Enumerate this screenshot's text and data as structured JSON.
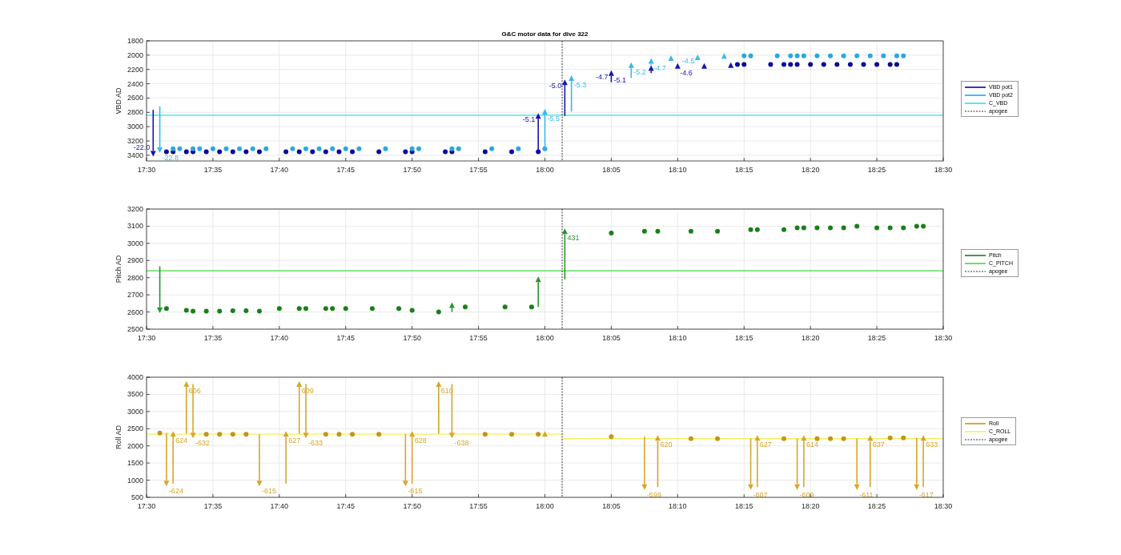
{
  "figure": {
    "title": "G&C motor data for dive 322"
  },
  "panels": [
    {
      "chart_data": {
        "type": "scatter",
        "ylabel": "VBD AD",
        "ylim": [
          3480,
          1800
        ],
        "grid": true,
        "categories": [
          "17:30",
          null,
          null,
          null,
          null,
          null,
          null,
          null,
          null,
          null,
          "17:35",
          null,
          null,
          null,
          null,
          null,
          null,
          null,
          null,
          null,
          "17:40",
          null,
          null,
          null,
          null,
          null,
          null,
          null,
          null,
          null,
          "17:45",
          null,
          null,
          null,
          null,
          null,
          null,
          null,
          null,
          null,
          "17:50",
          null,
          null,
          null,
          null,
          null,
          null,
          null,
          null,
          null,
          "17:55",
          null,
          null,
          null,
          null,
          null,
          null,
          null,
          null,
          null,
          "18:00",
          null,
          null,
          null,
          null,
          null,
          null,
          null,
          null,
          null,
          "18:05",
          null,
          null,
          null,
          null,
          null,
          null,
          null,
          null,
          null,
          "18:10",
          null,
          null,
          null,
          null,
          null,
          null,
          null,
          null,
          null,
          "18:15",
          null,
          null,
          null,
          null,
          null,
          null,
          null,
          null,
          null,
          "18:20",
          null,
          null,
          null,
          null,
          null,
          null,
          null,
          null,
          null,
          "18:25",
          null,
          null,
          null,
          null,
          null,
          null,
          null,
          null,
          null,
          "18:30"
        ],
        "yticks": [
          1800,
          2000,
          2200,
          2400,
          2600,
          2800,
          3000,
          3200,
          3400
        ],
        "series": [
          {
            "name": "VBD pot1",
            "color": "#0a0a9a",
            "values": [
              null,
              null,
              null,
              3350,
              3350,
              null,
              3350,
              3350,
              null,
              3350,
              null,
              3350,
              null,
              3350,
              null,
              3350,
              null,
              3350,
              null,
              null,
              null,
              3350,
              null,
              3350,
              null,
              3350,
              null,
              3350,
              null,
              3350,
              null,
              3350,
              null,
              null,
              null,
              3350,
              null,
              null,
              null,
              3350,
              3350,
              null,
              null,
              null,
              null,
              3350,
              3350,
              null,
              null,
              null,
              null,
              3350,
              null,
              null,
              null,
              3350,
              null,
              null,
              null,
              3350,
              null,
              null,
              null,
              null,
              null,
              null,
              null,
              null,
              null,
              null,
              null,
              null,
              null,
              null,
              null,
              null,
              null,
              null,
              null,
              null,
              null,
              null,
              null,
              null,
              null,
              null,
              null,
              null,
              null,
              2130,
              2130,
              null,
              null,
              null,
              2130,
              null,
              2130,
              2130,
              2130,
              null,
              2130,
              null,
              2130,
              null,
              2130,
              null,
              2130,
              null,
              2130,
              null,
              2130,
              null,
              2130,
              2130,
              null,
              null,
              null,
              null,
              null,
              null,
              null
            ]
          },
          {
            "color": "#1414b4",
            "values": [
              null,
              3380,
              null,
              null,
              null,
              null,
              null,
              null,
              null,
              null,
              null,
              null,
              null,
              null,
              null,
              null,
              null,
              null,
              null,
              null,
              null,
              null,
              null,
              null,
              null,
              null,
              null,
              null,
              null,
              null,
              null,
              null,
              null,
              null,
              null,
              null,
              null,
              null,
              null,
              null,
              null,
              null,
              null,
              null,
              null,
              null,
              null,
              null,
              null,
              null,
              null,
              null,
              null,
              null,
              null,
              null,
              null,
              null,
              null,
              2850,
              null,
              null,
              null,
              2380,
              null,
              null,
              null,
              null,
              null,
              null,
              2250,
              null,
              null,
              null,
              null,
              null,
              2180,
              null,
              null,
              null,
              2150,
              null,
              null,
              null,
              2150,
              null,
              null,
              null,
              2140,
              null,
              null,
              null,
              null,
              null,
              null,
              null,
              null,
              null,
              null,
              null,
              null,
              null,
              null,
              null,
              null,
              null,
              null,
              null,
              null,
              null,
              null,
              null,
              null,
              null,
              null,
              null,
              null,
              null,
              null,
              null,
              null
            ]
          },
          {
            "name": "VBD pot2",
            "color": "#2aa8e0",
            "values": [
              null,
              null,
              null,
              null,
              3310,
              3310,
              null,
              3310,
              3310,
              null,
              3310,
              null,
              3310,
              null,
              3310,
              null,
              3310,
              null,
              3310,
              null,
              null,
              null,
              3310,
              null,
              3310,
              null,
              3310,
              null,
              3310,
              null,
              3310,
              null,
              3310,
              null,
              null,
              null,
              3310,
              null,
              null,
              null,
              3310,
              3310,
              null,
              null,
              null,
              null,
              3310,
              3310,
              null,
              null,
              null,
              null,
              3310,
              null,
              null,
              null,
              3310,
              null,
              null,
              null,
              3310,
              null,
              null,
              null,
              null,
              null,
              null,
              null,
              null,
              null,
              null,
              null,
              null,
              null,
              null,
              null,
              null,
              null,
              null,
              null,
              null,
              null,
              null,
              null,
              null,
              null,
              null,
              null,
              null,
              null,
              2010,
              2010,
              null,
              null,
              null,
              2010,
              null,
              2010,
              2010,
              2010,
              null,
              2010,
              null,
              2010,
              null,
              2010,
              null,
              2010,
              null,
              2010,
              null,
              2010,
              null,
              2010,
              2010,
              null,
              null,
              null,
              null,
              null,
              null
            ]
          },
          {
            "color": "#3cb8ee",
            "values": [
              null,
              null,
              3330,
              null,
              null,
              null,
              null,
              null,
              null,
              null,
              null,
              null,
              null,
              null,
              null,
              null,
              null,
              null,
              null,
              null,
              null,
              null,
              null,
              null,
              null,
              null,
              null,
              null,
              null,
              null,
              null,
              null,
              null,
              null,
              null,
              null,
              null,
              null,
              null,
              null,
              null,
              null,
              null,
              null,
              null,
              null,
              null,
              null,
              null,
              null,
              null,
              null,
              null,
              null,
              null,
              null,
              null,
              null,
              null,
              null,
              2790,
              null,
              null,
              null,
              2320,
              null,
              null,
              null,
              null,
              null,
              null,
              null,
              null,
              2140,
              null,
              null,
              2080,
              null,
              null,
              2040,
              null,
              null,
              null,
              2030,
              null,
              null,
              null,
              2010,
              null,
              null,
              null,
              null,
              null,
              null,
              null,
              null,
              null,
              null,
              null,
              null,
              null,
              null,
              null,
              null,
              null,
              null,
              null,
              null,
              null,
              null,
              null,
              null,
              null,
              null,
              null,
              null,
              null,
              null,
              null,
              null,
              null
            ]
          }
        ],
        "ref_lines": [
          {
            "axis": "y",
            "value": 2840,
            "label": "C_VBD",
            "color": "#30e0f0"
          }
        ],
        "annotations": [
          {
            "text": "-22.0"
          },
          {
            "text": "-5.1"
          },
          {
            "text": "-5.0"
          },
          {
            "text": "-4.7"
          },
          {
            "text": "-5.1"
          },
          {
            "text": "-4.6"
          },
          {
            "text": "-22.8"
          },
          {
            "text": "-5.5"
          },
          {
            "text": "-5.3"
          },
          {
            "text": "-5.2"
          },
          {
            "text": "-4.7"
          },
          {
            "text": "-4.5"
          }
        ]
      },
      "vertical_marker": {
        "label": "apogee"
      }
    },
    {
      "chart_data": {
        "type": "scatter",
        "ylabel": "Pitch AD",
        "ylim": [
          2500,
          3200
        ],
        "grid": true,
        "categories": [
          "17:30",
          null,
          null,
          null,
          null,
          null,
          null,
          null,
          null,
          null,
          "17:35",
          null,
          null,
          null,
          null,
          null,
          null,
          null,
          null,
          null,
          "17:40",
          null,
          null,
          null,
          null,
          null,
          null,
          null,
          null,
          null,
          "17:45",
          null,
          null,
          null,
          null,
          null,
          null,
          null,
          null,
          null,
          "17:50",
          null,
          null,
          null,
          null,
          null,
          null,
          null,
          null,
          null,
          "17:55",
          null,
          null,
          null,
          null,
          null,
          null,
          null,
          null,
          null,
          "18:00",
          null,
          null,
          null,
          null,
          null,
          null,
          null,
          null,
          null,
          "18:05",
          null,
          null,
          null,
          null,
          null,
          null,
          null,
          null,
          null,
          "18:10",
          null,
          null,
          null,
          null,
          null,
          null,
          null,
          null,
          null,
          "18:15",
          null,
          null,
          null,
          null,
          null,
          null,
          null,
          null,
          null,
          "18:20",
          null,
          null,
          null,
          null,
          null,
          null,
          null,
          null,
          null,
          "18:25",
          null,
          null,
          null,
          null,
          null,
          null,
          null,
          null,
          null,
          "18:30"
        ],
        "yticks": [
          2500,
          2600,
          2700,
          2800,
          2900,
          3000,
          3100,
          3200
        ],
        "series": [
          {
            "name": "Pitch",
            "color": "#1a7f1a",
            "values": [
              null,
              null,
              null,
              2620,
              null,
              null,
              2610,
              2605,
              null,
              2605,
              null,
              2605,
              null,
              2607,
              null,
              2607,
              null,
              2605,
              null,
              null,
              2620,
              null,
              null,
              2620,
              2620,
              null,
              null,
              2620,
              2620,
              null,
              2620,
              null,
              null,
              null,
              2620,
              null,
              null,
              null,
              2620,
              null,
              2610,
              null,
              null,
              null,
              2600,
              null,
              null,
              null,
              2630,
              null,
              null,
              null,
              null,
              null,
              2630,
              null,
              null,
              null,
              2630,
              null,
              null,
              null,
              null,
              null,
              null,
              null,
              null,
              null,
              null,
              null,
              3060,
              null,
              null,
              null,
              null,
              3070,
              null,
              3070,
              null,
              null,
              null,
              null,
              3070,
              null,
              null,
              null,
              3070,
              null,
              null,
              null,
              null,
              3080,
              3080,
              null,
              null,
              null,
              3080,
              null,
              3090,
              3090,
              null,
              3090,
              null,
              3090,
              null,
              3090,
              null,
              3100,
              null,
              null,
              3090,
              null,
              3090,
              null,
              3090,
              null,
              3100,
              3100,
              null,
              null,
              null
            ]
          },
          {
            "color": "#26962a",
            "values": [
              null,
              null,
              2610,
              null,
              null,
              null,
              null,
              null,
              null,
              null,
              null,
              null,
              null,
              null,
              null,
              null,
              null,
              null,
              null,
              null,
              null,
              null,
              null,
              null,
              null,
              null,
              null,
              null,
              null,
              null,
              null,
              null,
              null,
              null,
              null,
              null,
              null,
              null,
              null,
              null,
              null,
              null,
              null,
              null,
              null,
              null,
              2640,
              null,
              null,
              null,
              null,
              null,
              null,
              null,
              null,
              null,
              null,
              null,
              null,
              2790,
              null,
              null,
              null,
              3070,
              null,
              null,
              null,
              null,
              null,
              null,
              null,
              null,
              null,
              null,
              null,
              null,
              null,
              null,
              null,
              null,
              null,
              null,
              null,
              null,
              null,
              null,
              null,
              null,
              null,
              null,
              null,
              null,
              null,
              null,
              null,
              null,
              null,
              null,
              null,
              null,
              null,
              null,
              null,
              null,
              null,
              null,
              null,
              null,
              null,
              null,
              null,
              null,
              null,
              null,
              null,
              null,
              null,
              null,
              null,
              null,
              null
            ]
          }
        ],
        "ref_lines": [
          {
            "axis": "y",
            "value": 2840,
            "label": "C_PITCH",
            "color": "#44d844"
          }
        ],
        "annotations": [
          {
            "text": "431"
          }
        ]
      },
      "vertical_marker": {
        "label": "apogee"
      }
    },
    {
      "chart_data": {
        "type": "scatter",
        "ylabel": "Roll AD",
        "ylim": [
          500,
          4000
        ],
        "grid": true,
        "categories": [
          "17:30",
          null,
          null,
          null,
          null,
          null,
          null,
          null,
          null,
          null,
          "17:35",
          null,
          null,
          null,
          null,
          null,
          null,
          null,
          null,
          null,
          "17:40",
          null,
          null,
          null,
          null,
          null,
          null,
          null,
          null,
          null,
          "17:45",
          null,
          null,
          null,
          null,
          null,
          null,
          null,
          null,
          null,
          "17:50",
          null,
          null,
          null,
          null,
          null,
          null,
          null,
          null,
          null,
          "17:55",
          null,
          null,
          null,
          null,
          null,
          null,
          null,
          null,
          null,
          "18:00",
          null,
          null,
          null,
          null,
          null,
          null,
          null,
          null,
          null,
          "18:05",
          null,
          null,
          null,
          null,
          null,
          null,
          null,
          null,
          null,
          "18:10",
          null,
          null,
          null,
          null,
          null,
          null,
          null,
          null,
          null,
          "18:15",
          null,
          null,
          null,
          null,
          null,
          null,
          null,
          null,
          null,
          "18:20",
          null,
          null,
          null,
          null,
          null,
          null,
          null,
          null,
          null,
          "18:25",
          null,
          null,
          null,
          null,
          null,
          null,
          null,
          null,
          null,
          "18:30"
        ],
        "yticks": [
          500,
          1000,
          1500,
          2000,
          2500,
          3000,
          3500,
          4000
        ],
        "series": [
          {
            "name": "Roll",
            "color": "#c4941c",
            "values": [
              null,
              null,
              2370,
              null,
              null,
              null,
              null,
              null,
              null,
              2340,
              null,
              2340,
              null,
              2340,
              null,
              2340,
              null,
              null,
              null,
              null,
              null,
              null,
              null,
              null,
              null,
              null,
              null,
              2340,
              null,
              2340,
              null,
              2340,
              null,
              null,
              null,
              2340,
              null,
              null,
              null,
              null,
              null,
              null,
              null,
              null,
              null,
              null,
              null,
              null,
              null,
              null,
              null,
              2340,
              null,
              null,
              null,
              2340,
              null,
              null,
              null,
              2340,
              null,
              null,
              null,
              null,
              null,
              null,
              null,
              null,
              null,
              null,
              2270,
              null,
              null,
              null,
              null,
              null,
              null,
              null,
              null,
              null,
              null,
              null,
              2210,
              null,
              null,
              null,
              2210,
              null,
              null,
              null,
              null,
              null,
              null,
              null,
              null,
              null,
              2210,
              null,
              null,
              null,
              null,
              2210,
              null,
              2210,
              null,
              2210,
              null,
              null,
              null,
              null,
              null,
              null,
              2230,
              null,
              2230,
              null,
              null,
              null,
              null,
              null,
              null
            ]
          },
          {
            "color": "#d8a628",
            "values": [
              null,
              null,
              null,
              900,
              2350,
              null,
              3800,
              2300,
              null,
              null,
              null,
              null,
              null,
              null,
              null,
              null,
              null,
              900,
              null,
              null,
              null,
              2350,
              null,
              3800,
              2300,
              null,
              null,
              null,
              null,
              null,
              null,
              null,
              null,
              null,
              null,
              null,
              null,
              null,
              null,
              900,
              2350,
              null,
              null,
              null,
              3800,
              null,
              2300,
              null,
              null,
              null,
              null,
              null,
              null,
              null,
              null,
              null,
              null,
              null,
              null,
              null,
              2350,
              null,
              null,
              null,
              null,
              null,
              null,
              null,
              null,
              null,
              null,
              null,
              null,
              null,
              null,
              800,
              null,
              2230,
              null,
              null,
              null,
              null,
              null,
              null,
              null,
              null,
              null,
              null,
              null,
              null,
              null,
              800,
              2230,
              null,
              null,
              null,
              null,
              null,
              800,
              2230,
              null,
              null,
              null,
              null,
              null,
              null,
              null,
              800,
              null,
              2230,
              null,
              null,
              null,
              null,
              null,
              null,
              800,
              2230,
              null,
              null,
              null
            ]
          }
        ],
        "ref_lines": [
          {
            "axis": "y",
            "value": 2340,
            "label": "C_ROLL",
            "color": "#f4ee60"
          },
          {
            "axis": "y",
            "value": 2210,
            "color": "#f4ee60"
          }
        ],
        "annotations": [
          {
            "text": "-624"
          },
          {
            "text": "624"
          },
          {
            "text": "606"
          },
          {
            "text": "-632"
          },
          {
            "text": "-615"
          },
          {
            "text": "627"
          },
          {
            "text": "609"
          },
          {
            "text": "-633"
          },
          {
            "text": "-615"
          },
          {
            "text": "628"
          },
          {
            "text": "610"
          },
          {
            "text": "-638"
          },
          {
            "text": "-599"
          },
          {
            "text": "620"
          },
          {
            "text": "-607"
          },
          {
            "text": "627"
          },
          {
            "text": "-609"
          },
          {
            "text": "614"
          },
          {
            "text": "-611"
          },
          {
            "text": "637"
          },
          {
            "text": "-617"
          },
          {
            "text": "633"
          }
        ]
      },
      "vertical_marker": {
        "label": "apogee"
      }
    }
  ]
}
